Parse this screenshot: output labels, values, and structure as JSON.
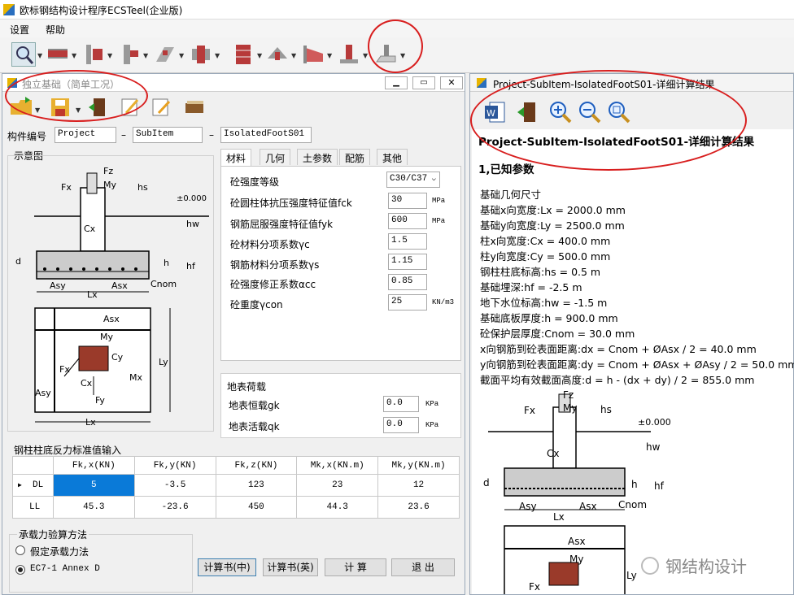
{
  "app": {
    "title": "欧标钢结构设计程序ECSTeel(企业版)"
  },
  "menu": [
    "设置",
    "帮助"
  ],
  "left": {
    "title": "独立基础（简单工况）",
    "member_label": "构件编号",
    "member": [
      "Project",
      "SubItem",
      "IsolatedFootS01"
    ],
    "dash": "–",
    "sketch_label": "示意图",
    "tabs": [
      "材料",
      "几何",
      "土参数",
      "配筋",
      "其他"
    ],
    "material": [
      {
        "label": "砼强度等级",
        "value": "C30/C37",
        "unit": ""
      },
      {
        "label": "砼圆柱体抗压强度特征值fck",
        "value": "30",
        "unit": "MPa"
      },
      {
        "label": "钢筋屈服强度特征值fyk",
        "value": "600",
        "unit": "MPa"
      },
      {
        "label": "砼材料分项系数γc",
        "value": "1.5",
        "unit": ""
      },
      {
        "label": "钢筋材料分项系数γs",
        "value": "1.15",
        "unit": ""
      },
      {
        "label": "砼强度修正系数αcc",
        "value": "0.85",
        "unit": ""
      },
      {
        "label": "砼重度γcon",
        "value": "25",
        "unit": "KN/m3"
      }
    ],
    "surface": {
      "title": "地表荷载",
      "rows": [
        {
          "label": "地表恒载gk",
          "value": "0.0",
          "unit": "KPa"
        },
        {
          "label": "地表活载qk",
          "value": "0.0",
          "unit": "KPa"
        }
      ]
    },
    "reaction": {
      "title": "钢柱柱底反力标准值输入",
      "headers": [
        "",
        "Fk,x(KN)",
        "Fk,y(KN)",
        "Fk,z(KN)",
        "Mk,x(KN.m)",
        "Mk,y(KN.m)"
      ],
      "rows": [
        {
          "name": "DL",
          "values": [
            "5",
            "-3.5",
            "123",
            "23",
            "12"
          ]
        },
        {
          "name": "LL",
          "values": [
            "45.3",
            "-23.6",
            "450",
            "44.3",
            "23.6"
          ]
        }
      ]
    },
    "method": {
      "title": "承载力验算方法",
      "options": [
        "假定承载力法",
        "EC7-1 Annex D"
      ]
    },
    "buttons": [
      "计算书(中)",
      "计算书(英)",
      "计 算",
      "退 出"
    ]
  },
  "right": {
    "title": "Project-SubItem-IsolatedFootS01-详细计算结果",
    "heading": "Project-SubItem-IsolatedFootS01-详细计算结果",
    "section": "1,已知参数",
    "lines": [
      "基础几何尺寸",
      "基础x向宽度:Lx = 2000.0 mm",
      "基础y向宽度:Ly = 2500.0 mm",
      "柱x向宽度:Cx = 400.0 mm",
      "柱y向宽度:Cy = 500.0 mm",
      "钢柱柱底标高:hs = 0.5 m",
      "基础埋深:hf = -2.5 m",
      "地下水位标高:hw = -1.5 m",
      "基础底板厚度:h = 900.0 mm",
      "砼保护层厚度:Cnom = 30.0 mm",
      "x向钢筋到砼表面距离:dx = Cnom + ØAsx / 2 = 40.0 mm",
      "y向钢筋到砼表面距离:dy = Cnom + ØAsx + ØAsy / 2 = 50.0 mm",
      "截面平均有效截面高度:d = h - (dx + dy) / 2 = 855.0 mm"
    ],
    "watermark": "钢结构设计"
  },
  "sketch": {
    "Fz": "Fz",
    "Fx": "Fx",
    "My": "My",
    "hs": "hs",
    "el": "±0.000",
    "hw": "hw",
    "Cx": "Cx",
    "d": "d",
    "h": "h",
    "hf": "hf",
    "Asy": "Asy",
    "Asx": "Asx",
    "Cnom": "Cnom",
    "Lx": "Lx",
    "Ly": "Ly",
    "Cy": "Cy",
    "Mx": "Mx",
    "Fy": "Fy"
  }
}
